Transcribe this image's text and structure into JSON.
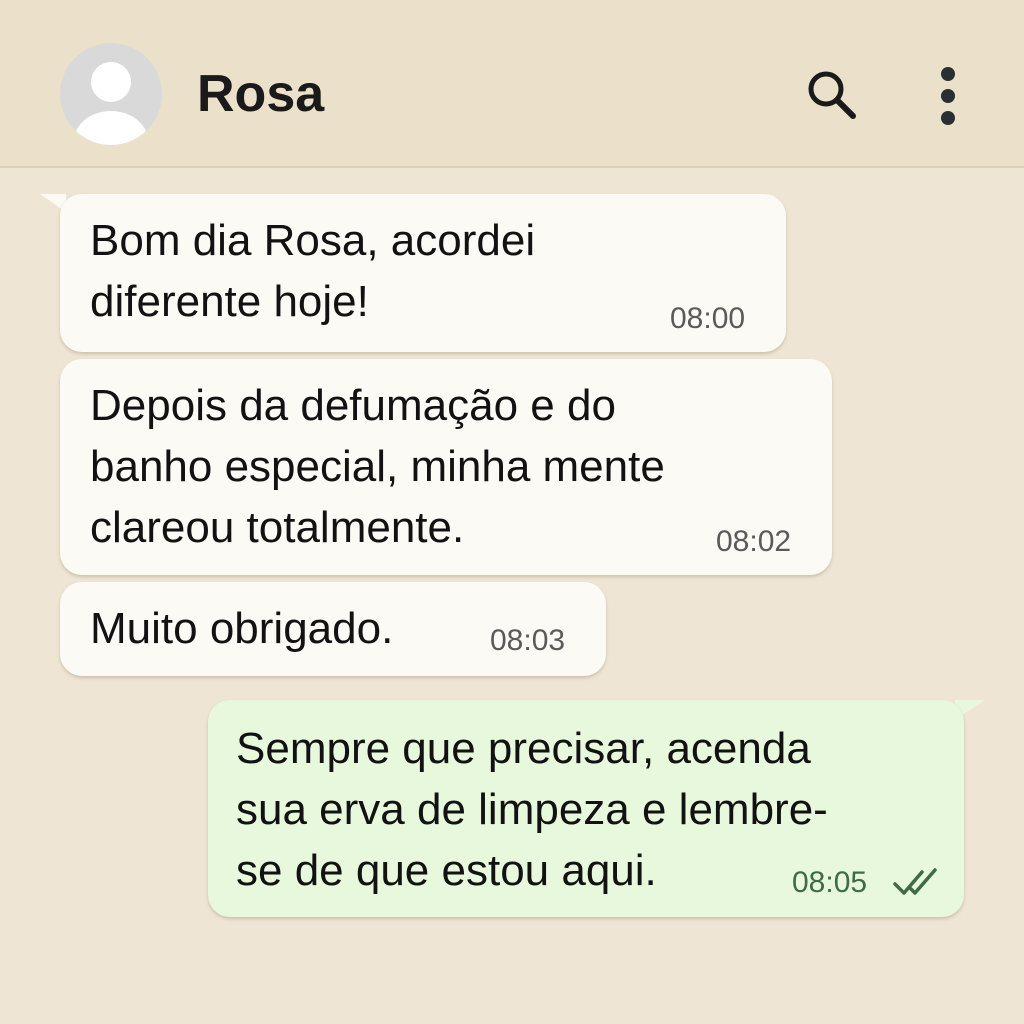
{
  "header": {
    "contact_name": "Rosa",
    "avatar_icon": "default-avatar-icon",
    "search_icon": "search-icon",
    "menu_icon": "more-vertical-icon"
  },
  "messages": [
    {
      "direction": "incoming",
      "lines": [
        "Bom dia Rosa, acordei",
        "diferente hoje!"
      ],
      "time": "08:00"
    },
    {
      "direction": "incoming",
      "lines": [
        "Depois da defumação e do",
        "banho especial, minha mente",
        "clareou totalmente."
      ],
      "time": "08:02"
    },
    {
      "direction": "incoming",
      "lines": [
        "Muito obrigado."
      ],
      "time": "08:03"
    },
    {
      "direction": "outgoing",
      "lines": [
        "Sempre que precisar, acenda",
        "sua erva de limpeza e lembre-",
        "se de que estou aqui."
      ],
      "time": "08:05",
      "status": "read-double-check-icon"
    }
  ],
  "colors": {
    "background": "#efe5d4",
    "header": "#ebe0c9",
    "incoming_bubble": "#fcfaf5",
    "outgoing_bubble": "#e8f8dc",
    "read_ticks": "#3f6b45"
  }
}
